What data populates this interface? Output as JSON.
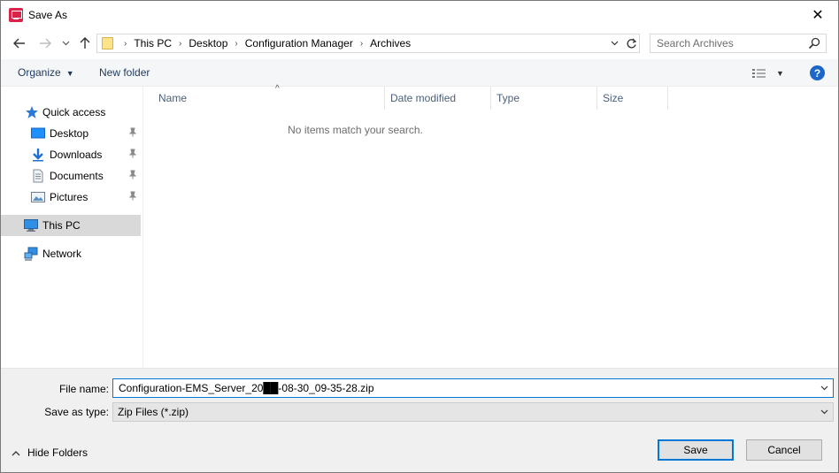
{
  "window": {
    "title": "Save As",
    "close_glyph": "✕"
  },
  "address_bar": {
    "crumbs": [
      "This PC",
      "Desktop",
      "Configuration Manager",
      "Archives"
    ],
    "separator": "›"
  },
  "search": {
    "placeholder": "Search Archives"
  },
  "toolbar": {
    "organize_label": "Organize",
    "new_folder_label": "New folder",
    "help_label": "?"
  },
  "nav_pane": {
    "items": [
      {
        "label": "Quick access",
        "icon": "star-icon"
      },
      {
        "label": "Desktop",
        "icon": "desktop-icon",
        "pinned": true
      },
      {
        "label": "Downloads",
        "icon": "download-icon",
        "pinned": true
      },
      {
        "label": "Documents",
        "icon": "documents-icon",
        "pinned": true
      },
      {
        "label": "Pictures",
        "icon": "pictures-icon",
        "pinned": true
      },
      {
        "label": "This PC",
        "icon": "computer-icon",
        "selected": true
      },
      {
        "label": "Network",
        "icon": "network-icon"
      }
    ]
  },
  "file_list": {
    "columns": [
      "Name",
      "Date modified",
      "Type",
      "Size"
    ],
    "empty_message": "No items match your search."
  },
  "bottom": {
    "file_name_label": "File name:",
    "file_name_value": "Configuration-EMS_Server_20██-08-30_09-35-28.zip",
    "save_as_type_label": "Save as type:",
    "save_as_type_value": "Zip Files (*.zip)",
    "hide_folders_label": "Hide Folders",
    "save_label": "Save",
    "cancel_label": "Cancel"
  },
  "colors": {
    "accent": "#0078d7",
    "toolbar_text": "#1e395b",
    "selected_bg": "#d9d9d9",
    "help_blue": "#1b66c9"
  }
}
